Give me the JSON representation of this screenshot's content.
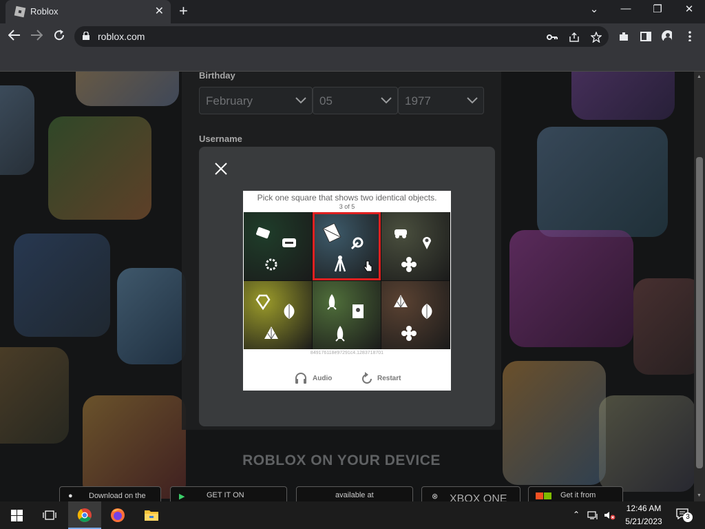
{
  "browser": {
    "tab_title": "Roblox",
    "url": "roblox.com",
    "tab_close": "✕",
    "new_tab": "+",
    "window_controls": {
      "dropdown": "⌄",
      "minimize": "—",
      "restore": "❐",
      "close": "✕"
    }
  },
  "form": {
    "birthday_label": "Birthday",
    "month": "February",
    "day": "05",
    "year": "1977",
    "username_label": "Username"
  },
  "captcha": {
    "instruction": "Pick one square that shows two identical objects.",
    "progress": "3 of 5",
    "session_code": "849176118e97291c4.1283718701",
    "audio_label": "Audio",
    "restart_label": "Restart",
    "selected_cell": 1,
    "cells": [
      {
        "bg": "#1f3d2a",
        "icons": [
          "card",
          "chest",
          "beads"
        ]
      },
      {
        "bg": "#3d5a6a",
        "icons": [
          "envelope",
          "satellite",
          "tripod"
        ]
      },
      {
        "bg": "#4a4f3e",
        "icons": [
          "car",
          "pin",
          "flower"
        ]
      },
      {
        "bg": "#9a9a2a",
        "icons": [
          "gem",
          "leaf",
          "shell"
        ]
      },
      {
        "bg": "#4f6e3a",
        "icons": [
          "rocket",
          "book",
          "rocket"
        ]
      },
      {
        "bg": "#5a4232",
        "icons": [
          "shell",
          "leaf",
          "flower"
        ]
      }
    ]
  },
  "footer": {
    "heading": "ROBLOX ON YOUR DEVICE",
    "stores": [
      "Download on the",
      "GET IT ON",
      "available at",
      "XBOX ONE",
      "Get it from"
    ]
  },
  "taskbar": {
    "time": "12:46 AM",
    "date": "5/21/2023",
    "notification_count": "3"
  },
  "colors": {
    "accent_red": "#e02020",
    "modal_bg": "#393b3d",
    "chrome_dark": "#202124",
    "chrome_toolbar": "#35363a"
  }
}
